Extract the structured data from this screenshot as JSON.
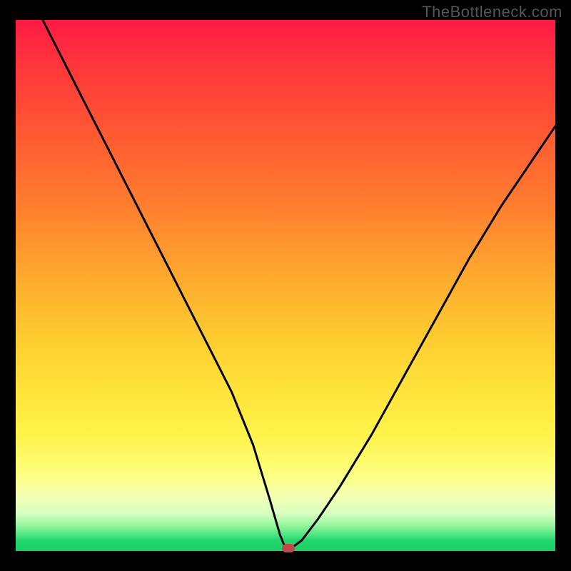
{
  "watermark": "TheBottleneck.com",
  "chart_data": {
    "type": "line",
    "title": "",
    "xlabel": "",
    "ylabel": "",
    "xlim": [
      0,
      100
    ],
    "ylim": [
      0,
      100
    ],
    "grid": false,
    "legend": false,
    "background_gradient": {
      "top": "#ff1a44",
      "mid": "#ffcc2f",
      "bottom": "#1ecf69"
    },
    "series": [
      {
        "name": "bottleneck-curve",
        "x": [
          5,
          8,
          12,
          16,
          20,
          24,
          28,
          32,
          36,
          40,
          44,
          47,
          49,
          50,
          51,
          53,
          56,
          60,
          66,
          72,
          78,
          84,
          90,
          96,
          100
        ],
        "y": [
          100,
          94,
          86,
          78,
          70,
          62,
          54,
          46,
          38,
          30,
          20,
          10,
          3,
          0.5,
          0.5,
          2,
          6,
          12,
          22,
          33,
          44,
          55,
          65,
          74,
          80
        ]
      }
    ],
    "marker": {
      "name": "optimal-point",
      "x": 50.5,
      "y": 0.5,
      "color": "#c14b4b"
    }
  }
}
